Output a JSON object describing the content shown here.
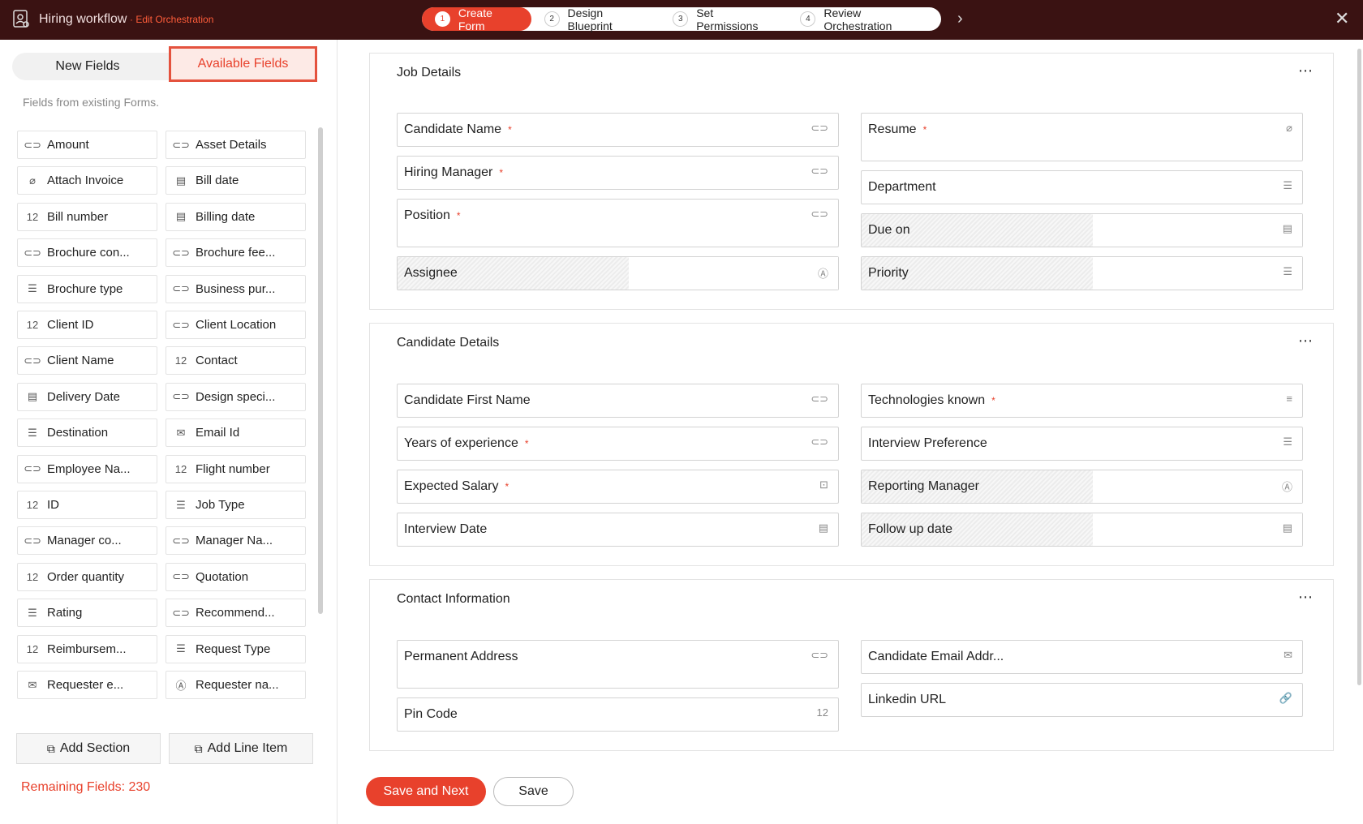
{
  "header": {
    "workflow_title": "Hiring workflow",
    "workflow_sub": "· Edit Orchestration",
    "steps": [
      {
        "num": "1",
        "label": "Create Form"
      },
      {
        "num": "2",
        "label": "Design Blueprint"
      },
      {
        "num": "3",
        "label": "Set Permissions"
      },
      {
        "num": "4",
        "label": "Review Orchestration"
      }
    ],
    "next_icon": "chevron-right-icon",
    "close_icon": "close-icon"
  },
  "sidebar": {
    "tab_new": "New Fields",
    "tab_available": "Available Fields",
    "hint": "Fields from existing Forms.",
    "fields": [
      {
        "label": "Amount",
        "icon": "⊂⊃"
      },
      {
        "label": "Asset Details",
        "icon": "⊂⊃"
      },
      {
        "label": "Attach Invoice",
        "icon": "⌀"
      },
      {
        "label": "Bill date",
        "icon": "▤"
      },
      {
        "label": "Bill number",
        "icon": "12"
      },
      {
        "label": "Billing date",
        "icon": "▤"
      },
      {
        "label": "Brochure con...",
        "icon": "⊂⊃"
      },
      {
        "label": "Brochure fee...",
        "icon": "⊂⊃"
      },
      {
        "label": "Brochure type",
        "icon": "☰"
      },
      {
        "label": "Business pur...",
        "icon": "⊂⊃"
      },
      {
        "label": "Client ID",
        "icon": "12"
      },
      {
        "label": "Client Location",
        "icon": "⊂⊃"
      },
      {
        "label": "Client Name",
        "icon": "⊂⊃"
      },
      {
        "label": "Contact",
        "icon": "12"
      },
      {
        "label": "Delivery Date",
        "icon": "▤"
      },
      {
        "label": "Design speci...",
        "icon": "⊂⊃"
      },
      {
        "label": "Destination",
        "icon": "☰"
      },
      {
        "label": "Email Id",
        "icon": "✉"
      },
      {
        "label": "Employee Na...",
        "icon": "⊂⊃"
      },
      {
        "label": "Flight number",
        "icon": "12"
      },
      {
        "label": "ID",
        "icon": "12"
      },
      {
        "label": "Job Type",
        "icon": "☰"
      },
      {
        "label": "Manager co...",
        "icon": "⊂⊃"
      },
      {
        "label": "Manager Na...",
        "icon": "⊂⊃"
      },
      {
        "label": "Order quantity",
        "icon": "12"
      },
      {
        "label": "Quotation",
        "icon": "⊂⊃"
      },
      {
        "label": "Rating",
        "icon": "☰"
      },
      {
        "label": "Recommend...",
        "icon": "⊂⊃"
      },
      {
        "label": "Reimbursem...",
        "icon": "12"
      },
      {
        "label": "Request Type",
        "icon": "☰"
      },
      {
        "label": "Requester e...",
        "icon": "✉"
      },
      {
        "label": "Requester na...",
        "icon": "Ⓐ"
      }
    ],
    "add_section": "Add Section",
    "add_line_item": "Add Line Item",
    "remaining": "Remaining Fields: 230"
  },
  "sections": [
    {
      "title": "Job Details",
      "fields": [
        {
          "label": "Candidate Name",
          "required": "*",
          "icon": "⊂⊃"
        },
        {
          "label": "Resume",
          "required": "*",
          "icon": "⌀"
        },
        {
          "label": "Hiring Manager",
          "required": "*",
          "icon": "⊂⊃"
        },
        {
          "label": "Department",
          "required": "",
          "icon": "☰"
        },
        {
          "label": "Position",
          "required": "*",
          "icon": "⊂⊃"
        },
        {
          "label": "Due on",
          "required": "",
          "icon": "▤"
        },
        {
          "label": "Assignee",
          "required": "",
          "icon": "Ⓐ"
        },
        {
          "label": "Priority",
          "required": "",
          "icon": "☰"
        }
      ]
    },
    {
      "title": "Candidate Details",
      "fields": [
        {
          "label": "Candidate First Name",
          "required": "",
          "icon": "⊂⊃"
        },
        {
          "label": "Technologies known",
          "required": "*",
          "icon": "≡"
        },
        {
          "label": "Years of experience",
          "required": "*",
          "icon": "⊂⊃"
        },
        {
          "label": "Interview Preference",
          "required": "",
          "icon": "☰"
        },
        {
          "label": "Expected Salary",
          "required": "*",
          "icon": "⊡"
        },
        {
          "label": "Reporting Manager",
          "required": "",
          "icon": "Ⓐ"
        },
        {
          "label": "Interview Date",
          "required": "",
          "icon": "▤"
        },
        {
          "label": "Follow up date",
          "required": "",
          "icon": "▤"
        }
      ]
    },
    {
      "title": "Contact Information",
      "fields": [
        {
          "label": "Permanent Address",
          "required": "",
          "icon": "⊂⊃"
        },
        {
          "label": "Candidate Email Addr...",
          "required": "",
          "icon": "✉"
        },
        {
          "label": "Linkedin URL",
          "required": "",
          "icon": "🔗"
        },
        {
          "label": "Pin Code",
          "required": "",
          "icon": "12"
        }
      ]
    }
  ],
  "actions": {
    "save_next": "Save and Next",
    "save": "Save"
  },
  "more_icon": "⋯"
}
